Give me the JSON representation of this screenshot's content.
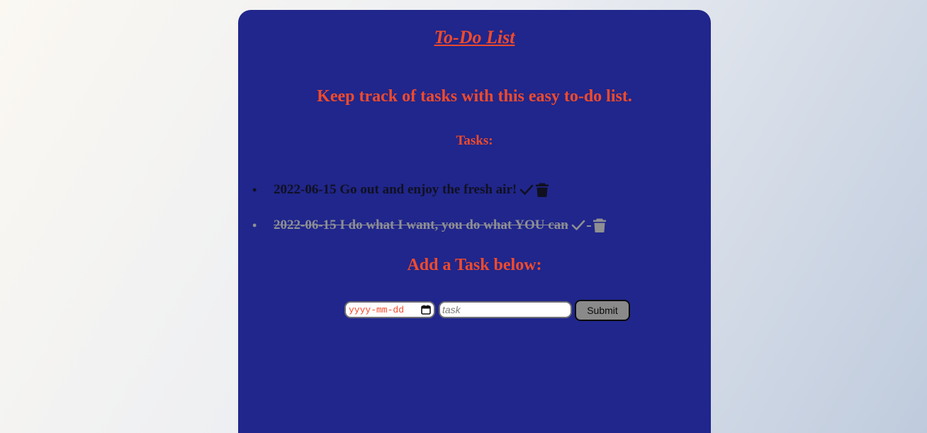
{
  "page": {
    "title": "To-Do List",
    "tagline": "Keep track of tasks with this easy to-do list.",
    "tasks_heading": "Tasks:",
    "add_heading": "Add a Task below:"
  },
  "tasks": [
    {
      "text": "2022-06-15 Go out and enjoy the fresh air!",
      "done": false,
      "icons": [
        "check-icon",
        "trash-icon"
      ]
    },
    {
      "text": "2022-06-15 I do what I want, you do what YOU can",
      "done": true,
      "icons": [
        "check-icon",
        "trash-icon"
      ]
    }
  ],
  "form": {
    "date_placeholder": "yyyy-mm-dd",
    "date_icon": "calendar-icon",
    "task_placeholder": "task",
    "submit_label": "Submit"
  },
  "colors": {
    "card_background": "#20268b",
    "heading": "#f24a2b",
    "task_text": "#101020",
    "done_task_text": "#8f8f93",
    "submit_background": "#8a8a8a"
  }
}
